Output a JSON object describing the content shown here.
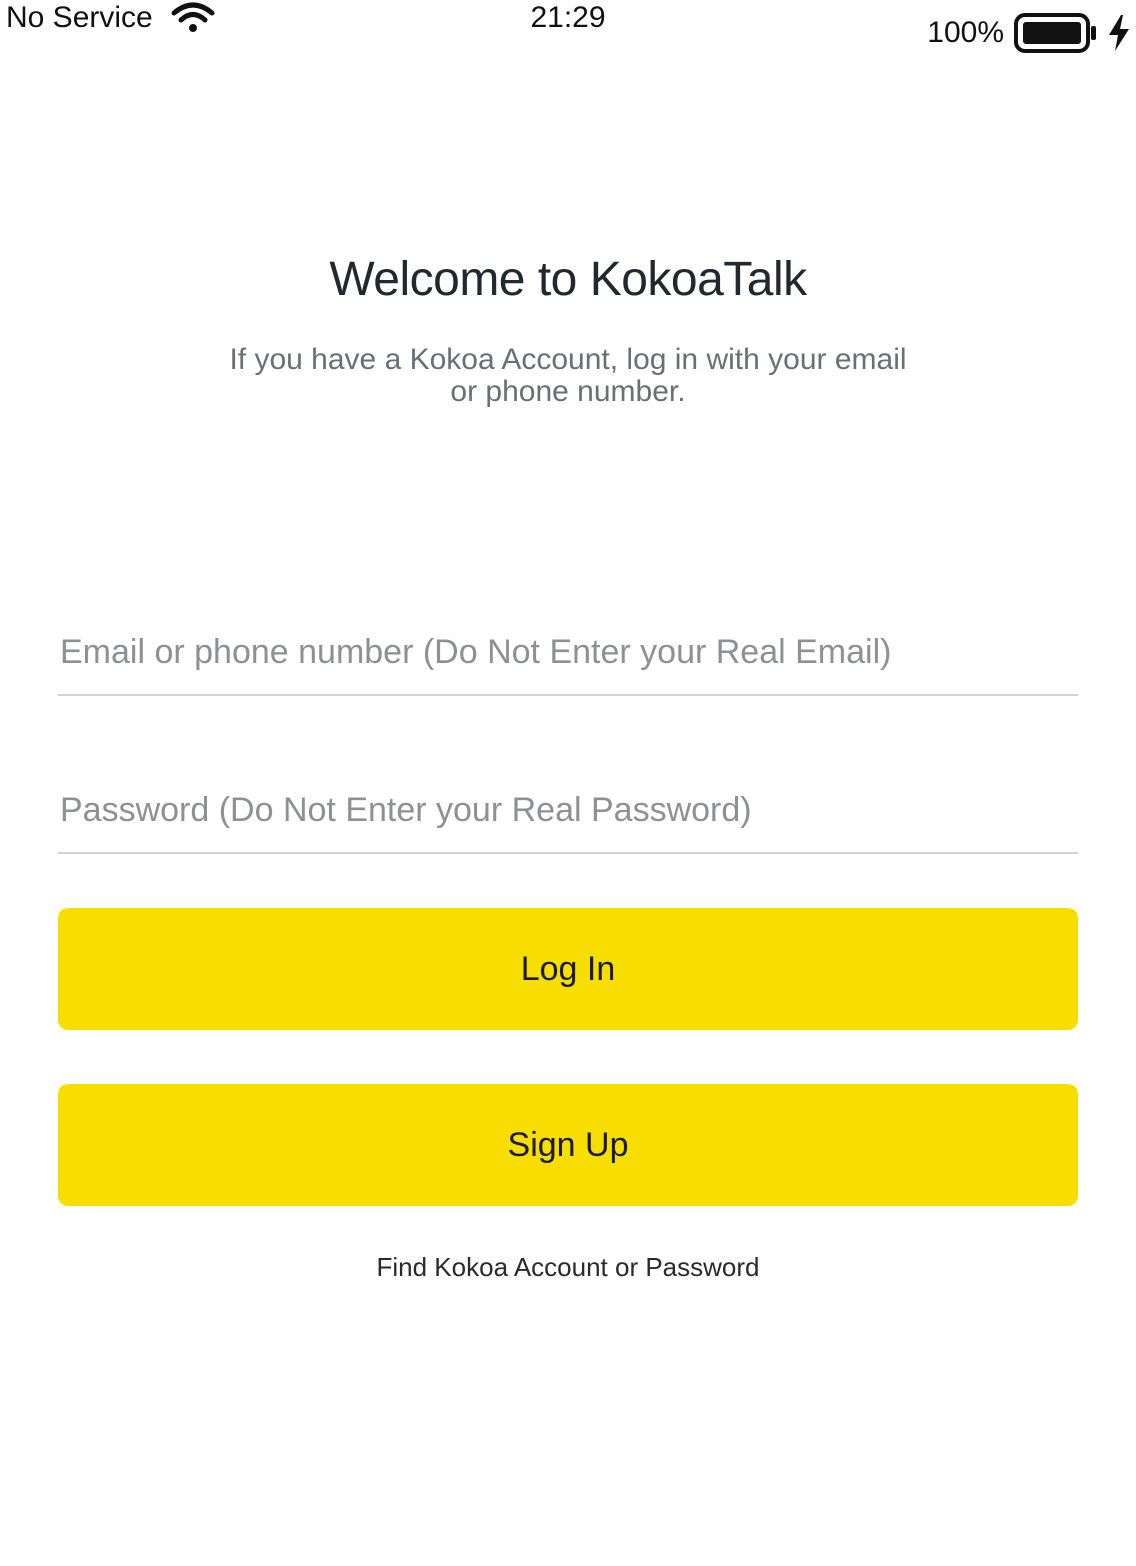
{
  "status_bar": {
    "carrier": "No Service",
    "time": "21:29",
    "battery_percent": "100%",
    "battery_level": 1.0,
    "icons": [
      "wifi-icon",
      "battery-icon",
      "charging-bolt-icon"
    ]
  },
  "header": {
    "title": "Welcome to KokoaTalk",
    "subtitle": "If you have a Kokoa Account, log in with your email or phone number."
  },
  "form": {
    "email_placeholder": "Email or phone number (Do Not Enter your Real Email)",
    "email_value": "",
    "password_placeholder": "Password (Do Not Enter your Real Password)",
    "password_value": ""
  },
  "buttons": {
    "login_label": "Log In",
    "signup_label": "Sign Up"
  },
  "links": {
    "find_account": "Find Kokoa Account or Password"
  },
  "colors": {
    "button_bg": "#f7dd00",
    "placeholder": "#8e9094",
    "divider": "#d3d3d3"
  }
}
